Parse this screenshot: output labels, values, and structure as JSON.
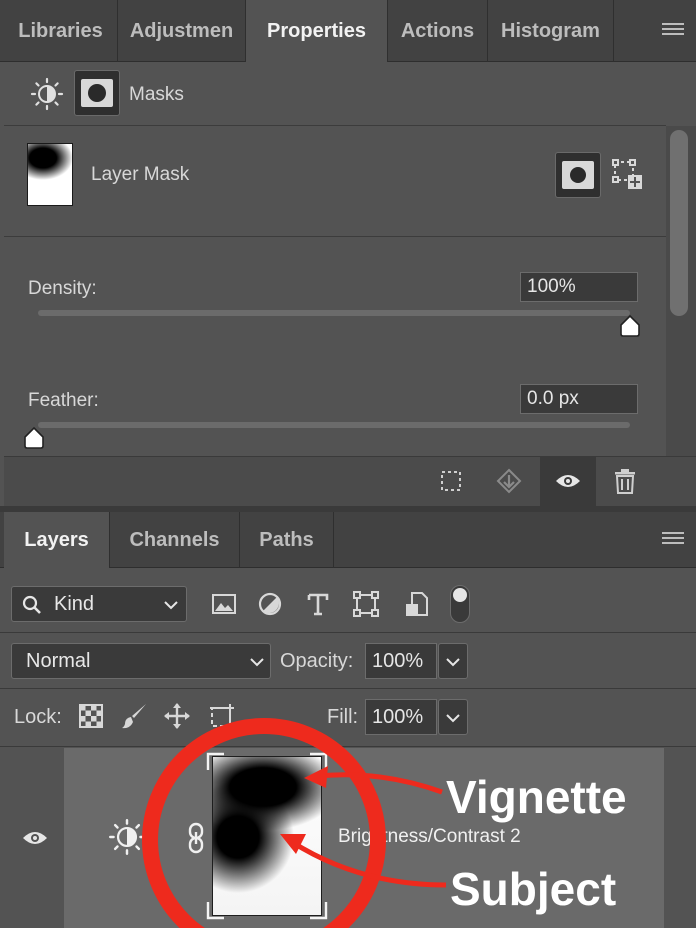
{
  "top_tabs": [
    "Libraries",
    "Adjustmen",
    "Properties",
    "Actions",
    "Histogram"
  ],
  "properties": {
    "section_label": "Masks",
    "mask_title": "Layer Mask",
    "density_label": "Density:",
    "density_value": "100%",
    "density_level": 1.0,
    "feather_label": "Feather:",
    "feather_value": "0.0 px",
    "feather_level": 0.0
  },
  "layer_tabs": [
    "Layers",
    "Channels",
    "Paths"
  ],
  "filter": {
    "kind_label": "Kind"
  },
  "blend": {
    "mode": "Normal",
    "opacity_label": "Opacity:",
    "opacity_value": "100%"
  },
  "lock": {
    "lock_label": "Lock:",
    "fill_label": "Fill:",
    "fill_value": "100%"
  },
  "layer": {
    "name": "Brightness/Contrast 2"
  },
  "annotations": {
    "vignette": "Vignette",
    "subject": "Subject",
    "color": "#ee2a1d"
  },
  "colors": {
    "panel": "#535353",
    "tabbar": "#424242",
    "field": "#3a3a3a",
    "annotation": "#ee2a1d"
  }
}
